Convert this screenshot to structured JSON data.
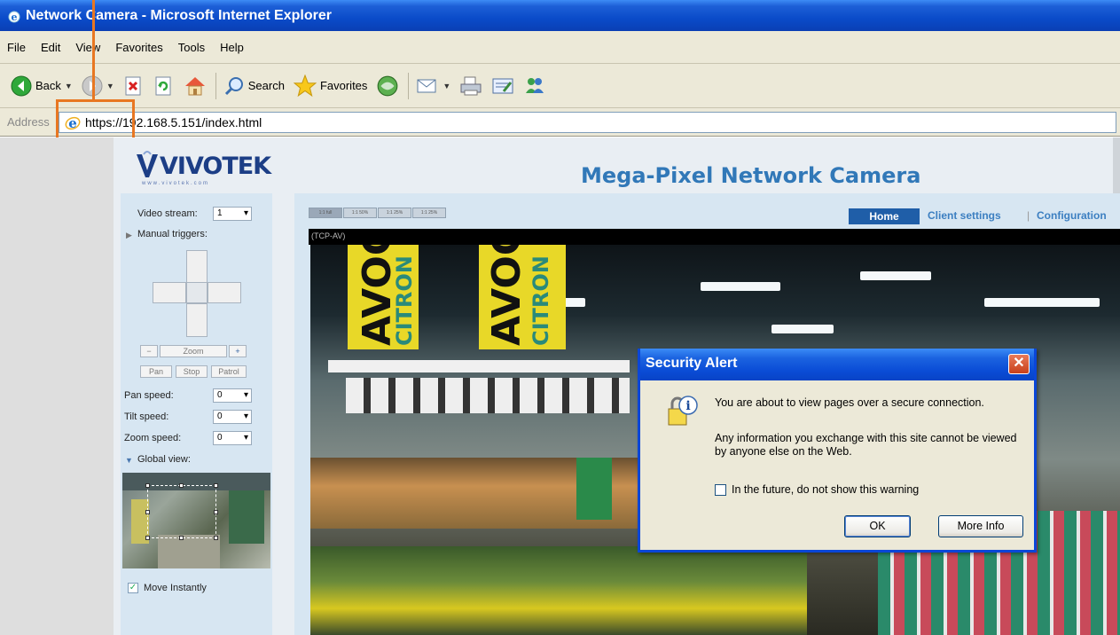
{
  "window": {
    "title": "Network Camera - Microsoft Internet Explorer"
  },
  "menu": {
    "items": [
      "File",
      "Edit",
      "View",
      "Favorites",
      "Tools",
      "Help"
    ]
  },
  "toolbar": {
    "back_label": "Back",
    "search_label": "Search",
    "favorites_label": "Favorites"
  },
  "address": {
    "label": "Address",
    "url": "https://192.168.5.151/index.html"
  },
  "page": {
    "logo": "VIVOTEK",
    "logo_sub": "www.vivotek.com",
    "title": "Mega-Pixel Network Camera",
    "nav": {
      "home": "Home",
      "client_settings": "Client settings",
      "configuration": "Configuration"
    },
    "stream_tabs": [
      "1:1 full",
      "1:1 50%",
      "1:1 25%",
      "1:1 25%"
    ],
    "video_header": "(TCP-AV)",
    "banner_words": [
      "AVOC",
      "CITRON",
      "AVOC",
      "CITRON"
    ]
  },
  "left_panel": {
    "video_stream_label": "Video stream:",
    "video_stream_value": "1",
    "manual_triggers_label": "Manual triggers:",
    "zoom_label": "Zoom",
    "zoom_minus": "−",
    "zoom_plus": "+",
    "pan_label": "Pan",
    "stop_label": "Stop",
    "patrol_label": "Patrol",
    "pan_speed_label": "Pan speed:",
    "pan_speed_value": "0",
    "tilt_speed_label": "Tilt speed:",
    "tilt_speed_value": "0",
    "zoom_speed_label": "Zoom speed:",
    "zoom_speed_value": "0",
    "global_view_label": "Global view:",
    "move_instantly_label": "Move Instantly",
    "move_instantly_checked": "✓"
  },
  "dialog": {
    "title": "Security Alert",
    "close": "✕",
    "line1": "You are about to view pages over a secure connection.",
    "line2": "Any information you exchange with this site cannot be viewed by anyone else on the Web.",
    "checkbox_label": "In the future, do not show this warning",
    "ok": "OK",
    "more_info": "More Info"
  },
  "colors": {
    "accent": "#e87722",
    "xp_blue": "#0a4bc9",
    "title_blue": "#3178b8"
  }
}
